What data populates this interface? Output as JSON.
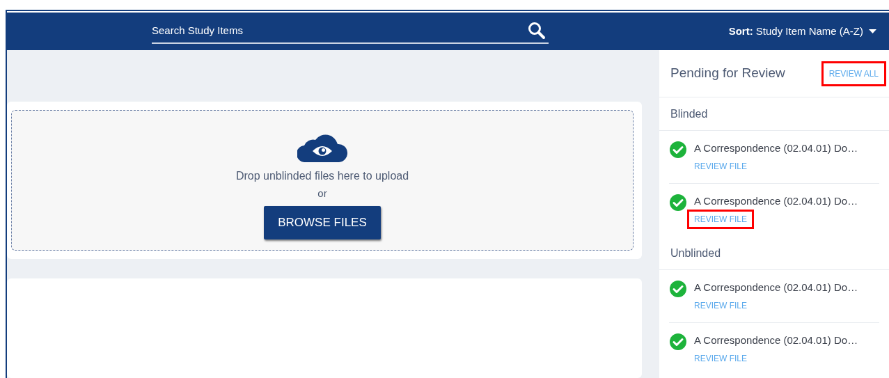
{
  "header": {
    "search": {
      "placeholder": "Search Study Items"
    },
    "sort": "**Sort:** Study Item Name (A-Z)"
  },
  "upload": {
    "message": "Drop unblinded files here to upload",
    "separator": "or",
    "button": "BROWSE FILES"
  },
  "review_panel": {
    "title": "Pending for Review",
    "review_all": {
      "label": "REVIEW ALL",
      "highlighted": true
    },
    "groups": [
      {
        "label": "Blinded",
        "items": [
          {
            "name": "A Correspondence (02.04.01) Do…",
            "action": "REVIEW FILE",
            "highlighted": false
          },
          {
            "name": "A Correspondence (02.04.01) Do…",
            "action": "REVIEW FILE",
            "highlighted": true
          }
        ]
      },
      {
        "label": "Unblinded",
        "items": [
          {
            "name": "A Correspondence (02.04.01) Do…",
            "action": "REVIEW FILE",
            "highlighted": false
          },
          {
            "name": "A Correspondence (02.04.01) Do…",
            "action": "REVIEW FILE",
            "highlighted": false
          }
        ]
      }
    ]
  }
}
